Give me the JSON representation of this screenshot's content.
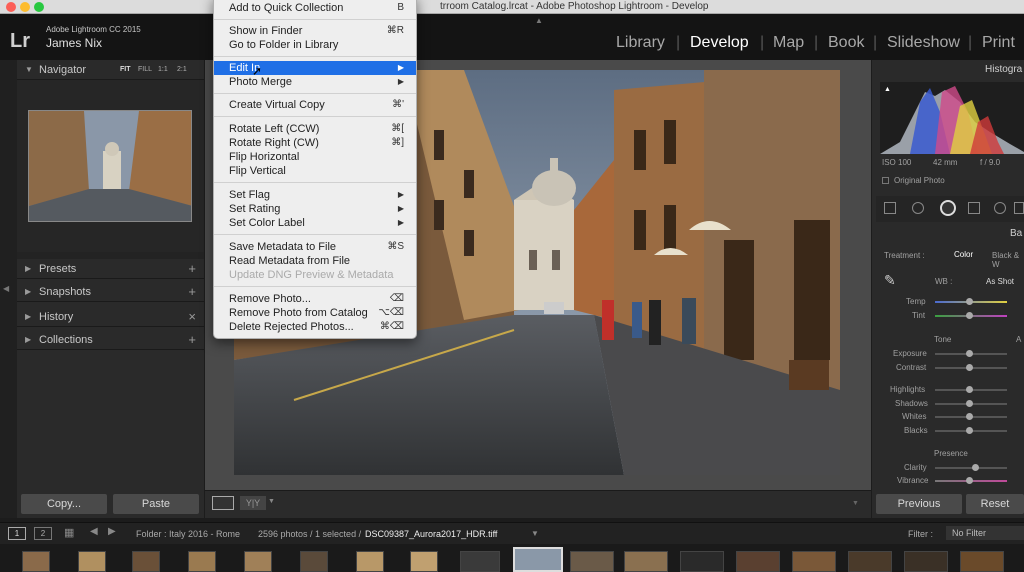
{
  "window": {
    "title": "trroom Catalog.lrcat - Adobe Photoshop Lightroom - Develop"
  },
  "identity": {
    "logo": "Lr",
    "app_version": "Adobe Lightroom CC 2015",
    "user": "James Nix"
  },
  "modules": [
    "Library",
    "Develop",
    "Map",
    "Book",
    "Slideshow",
    "Print"
  ],
  "active_module": "Develop",
  "navigator": {
    "label": "Navigator",
    "zoom_options": [
      "FIT",
      "FILL",
      "1:1",
      "2:1"
    ]
  },
  "left_panels": [
    {
      "label": "Presets",
      "action": "+"
    },
    {
      "label": "Snapshots",
      "action": "+"
    },
    {
      "label": "History",
      "action": "×"
    },
    {
      "label": "Collections",
      "action": "+"
    }
  ],
  "left_buttons": {
    "copy": "Copy...",
    "paste": "Paste"
  },
  "menu": {
    "items": [
      {
        "label": "Add to Quick Collection",
        "shortcut": "B"
      },
      {
        "label": "Show in Finder",
        "shortcut": "⌘R"
      },
      {
        "label": "Go to Folder in Library",
        "shortcut": ""
      },
      {
        "label": "Edit In",
        "shortcut": "▶",
        "highlighted": true
      },
      {
        "label": "Photo Merge",
        "shortcut": "▶"
      },
      {
        "label": "Create Virtual Copy",
        "shortcut": "⌘'"
      },
      {
        "label": "Rotate Left (CCW)",
        "shortcut": "⌘["
      },
      {
        "label": "Rotate Right (CW)",
        "shortcut": "⌘]"
      },
      {
        "label": "Flip Horizontal",
        "shortcut": ""
      },
      {
        "label": "Flip Vertical",
        "shortcut": ""
      },
      {
        "label": "Set Flag",
        "shortcut": "▶"
      },
      {
        "label": "Set Rating",
        "shortcut": "▶"
      },
      {
        "label": "Set Color Label",
        "shortcut": "▶"
      },
      {
        "label": "Save Metadata to File",
        "shortcut": "⌘S"
      },
      {
        "label": "Read Metadata from File",
        "shortcut": ""
      },
      {
        "label": "Update DNG Preview & Metadata",
        "shortcut": "",
        "disabled": true
      },
      {
        "label": "Remove Photo...",
        "shortcut": "⌫"
      },
      {
        "label": "Remove Photo from Catalog",
        "shortcut": "⌥⌫"
      },
      {
        "label": "Delete Rejected Photos...",
        "shortcut": "⌘⌫"
      }
    ]
  },
  "histogram": {
    "label": "Histogra",
    "iso": "ISO 100",
    "focal": "42 mm",
    "aperture": "f / 9.0",
    "original_photo": "Original Photo"
  },
  "basic": {
    "label": "Ba",
    "treatment_label": "Treatment :",
    "treatment_color": "Color",
    "treatment_bw": "Black & W",
    "wb_label": "WB :",
    "wb_value": "As Shot",
    "temp": "Temp",
    "tint": "Tint",
    "tone": "Tone",
    "tone_auto": "A",
    "exposure": "Exposure",
    "contrast": "Contrast",
    "highlights": "Highlights",
    "shadows": "Shadows",
    "whites": "Whites",
    "blacks": "Blacks",
    "presence": "Presence",
    "clarity": "Clarity",
    "vibrance": "Vibrance"
  },
  "right_buttons": {
    "previous": "Previous",
    "reset": "Reset"
  },
  "filmstrip": {
    "page1": "1",
    "page2": "2",
    "folder_label": "Folder : Italy 2016 - Rome",
    "count": "2596 photos / 1 selected /",
    "filename": "DSC09387_Aurora2017_HDR.tiff",
    "filter_label": "Filter :",
    "filter_value": "No Filter"
  },
  "colors": {
    "accent": "#1f6fe6",
    "panel": "#2a2a2a",
    "background": "#1c1c1c"
  }
}
